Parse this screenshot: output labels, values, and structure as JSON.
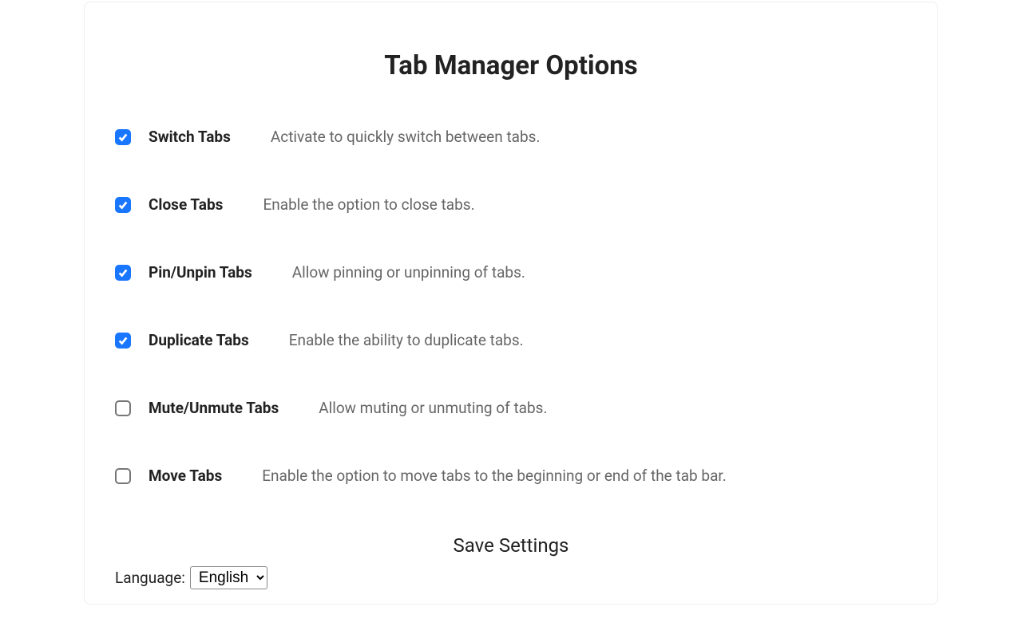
{
  "title": "Tab Manager Options",
  "options": [
    {
      "label": "Switch Tabs",
      "desc": "Activate to quickly switch between tabs.",
      "checked": true
    },
    {
      "label": "Close Tabs",
      "desc": "Enable the option to close tabs.",
      "checked": true
    },
    {
      "label": "Pin/Unpin Tabs",
      "desc": "Allow pinning or unpinning of tabs.",
      "checked": true
    },
    {
      "label": "Duplicate Tabs",
      "desc": "Enable the ability to duplicate tabs.",
      "checked": true
    },
    {
      "label": "Mute/Unmute Tabs",
      "desc": "Allow muting or unmuting of tabs.",
      "checked": false
    },
    {
      "label": "Move Tabs",
      "desc": "Enable the option to move tabs to the beginning or end of the tab bar.",
      "checked": false
    }
  ],
  "save_label": "Save Settings",
  "language_label": "Language:",
  "language_selected": "English"
}
